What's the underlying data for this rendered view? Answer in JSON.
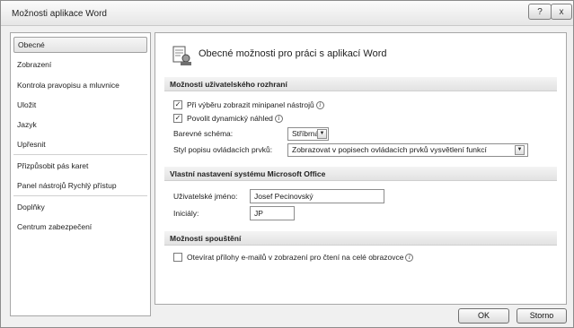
{
  "window": {
    "title": "Možnosti aplikace Word"
  },
  "titlebar": {
    "help_label": "?",
    "close_label": "x"
  },
  "nav": {
    "items": [
      {
        "label": "Obecné"
      },
      {
        "label": "Zobrazení"
      },
      {
        "label": "Kontrola pravopisu a mluvnice"
      },
      {
        "label": "Uložit"
      },
      {
        "label": "Jazyk"
      },
      {
        "label": "Upřesnit"
      },
      {
        "label": "Přizpůsobit pás karet"
      },
      {
        "label": "Panel nástrojů Rychlý přístup"
      },
      {
        "label": "Doplňky"
      },
      {
        "label": "Centrum zabezpečení"
      }
    ],
    "selected_index": 0
  },
  "content": {
    "header": "Obecné možnosti pro práci s aplikací Word",
    "ui_section": {
      "title": "Možnosti uživatelského rozhraní",
      "minitoolbar": {
        "label": "Při výběru zobrazit minipanel nástrojů",
        "checked": true
      },
      "live_preview": {
        "label": "Povolit dynamický náhled",
        "checked": true
      },
      "color_scheme": {
        "label": "Barevné schéma:",
        "value": "Stříbrná"
      },
      "screentip_style": {
        "label": "Styl popisu ovládacích prvků:",
        "value": "Zobrazovat v popisech ovládacích prvků vysvětlení funkcí"
      }
    },
    "office_section": {
      "title": "Vlastní nastavení systému Microsoft Office",
      "username": {
        "label": "Uživatelské jméno:",
        "value": "Josef Pecinovský"
      },
      "initials": {
        "label": "Iniciály:",
        "value": "JP"
      }
    },
    "startup_section": {
      "title": "Možnosti spouštění",
      "reading_view": {
        "label": "Otevírat přílohy e-mailů v zobrazení pro čtení na celé obrazovce",
        "checked": false
      }
    }
  },
  "footer": {
    "ok_label": "OK",
    "cancel_label": "Storno"
  },
  "icons": {
    "info": "info-icon",
    "checked": "✓",
    "dropdown": "▼"
  }
}
